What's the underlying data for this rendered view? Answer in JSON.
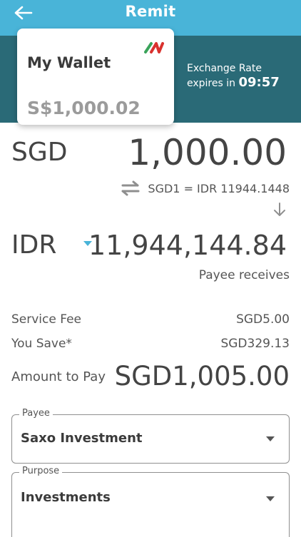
{
  "header": {
    "title": "Remit",
    "back_icon": "arrow-left-icon"
  },
  "wallet": {
    "name": "My Wallet",
    "balance": "S$1,000.02",
    "logo_icon": "brand-logo-icon"
  },
  "exchange": {
    "line1": "Exchange Rate",
    "line2_prefix": "expires in",
    "timer": "09:57"
  },
  "source": {
    "currency": "SGD",
    "amount": "1,000.00"
  },
  "rate": {
    "text": "SGD1 = IDR 11944.1448",
    "icon": "swap-icon"
  },
  "destination": {
    "currency": "IDR",
    "amount": "11,944,144.84",
    "caption": "Payee receives"
  },
  "summary": {
    "service_fee_label": "Service Fee",
    "service_fee_value": "SGD5.00",
    "you_save_label": "You Save*",
    "you_save_value": "SGD329.13",
    "amount_to_pay_label": "Amount to Pay",
    "amount_to_pay_value": "SGD1,005.00"
  },
  "fields": {
    "payee": {
      "label": "Payee",
      "value": "Saxo Investment"
    },
    "purpose": {
      "label": "Purpose",
      "value": "Investments"
    }
  },
  "colors": {
    "header": "#49B4D8",
    "band": "#2A6A77",
    "accent": "#49B4D8"
  }
}
